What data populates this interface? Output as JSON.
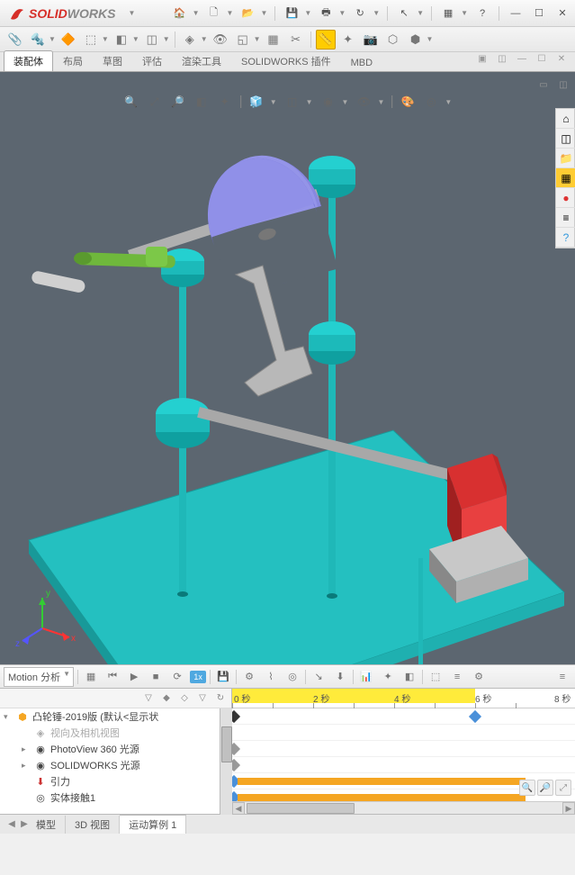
{
  "app": {
    "name_red": "SOLID",
    "name_gray": "WORKS"
  },
  "tabs": [
    {
      "label": "装配体",
      "active": true
    },
    {
      "label": "布局",
      "active": false
    },
    {
      "label": "草图",
      "active": false
    },
    {
      "label": "评估",
      "active": false
    },
    {
      "label": "渲染工具",
      "active": false
    },
    {
      "label": "SOLIDWORKS 插件",
      "active": false
    },
    {
      "label": "MBD",
      "active": false
    }
  ],
  "motion": {
    "study_type": "Motion 分析",
    "speed": "1x"
  },
  "timeline": {
    "start": 0,
    "end": 8,
    "unit": "秒",
    "labels": [
      "0 秒",
      "2 秒",
      "4 秒",
      "6 秒",
      "8 秒"
    ],
    "yellow_end": 6
  },
  "tree": {
    "root": "凸轮锤-2019版 (默认<显示状",
    "items": [
      {
        "label": "视向及相机视图",
        "icon": "◈",
        "dim": true
      },
      {
        "label": "PhotoView 360 光源",
        "icon": "◉",
        "expandable": true
      },
      {
        "label": "SOLIDWORKS 光源",
        "icon": "◉",
        "expandable": true
      },
      {
        "label": "引力",
        "icon": "⬇"
      },
      {
        "label": "实体接触1",
        "icon": "◎"
      }
    ]
  },
  "bottom_tabs": [
    {
      "label": "模型",
      "active": false
    },
    {
      "label": "3D 视图",
      "active": false
    },
    {
      "label": "运动算例 1",
      "active": true
    }
  ],
  "triad": {
    "x": "x",
    "y": "y",
    "z": "z"
  },
  "side_icons": [
    "⌂",
    "◫",
    "📁",
    "🔳",
    "⚙",
    "●",
    "?"
  ],
  "colors": {
    "viewport_bg": "#5c6670",
    "platform": "#1fb8b8",
    "cam_disc": "#7e7ed8",
    "handle": "#6fb83c",
    "red_block": "#d83030",
    "steel": "#bfbfbf"
  }
}
